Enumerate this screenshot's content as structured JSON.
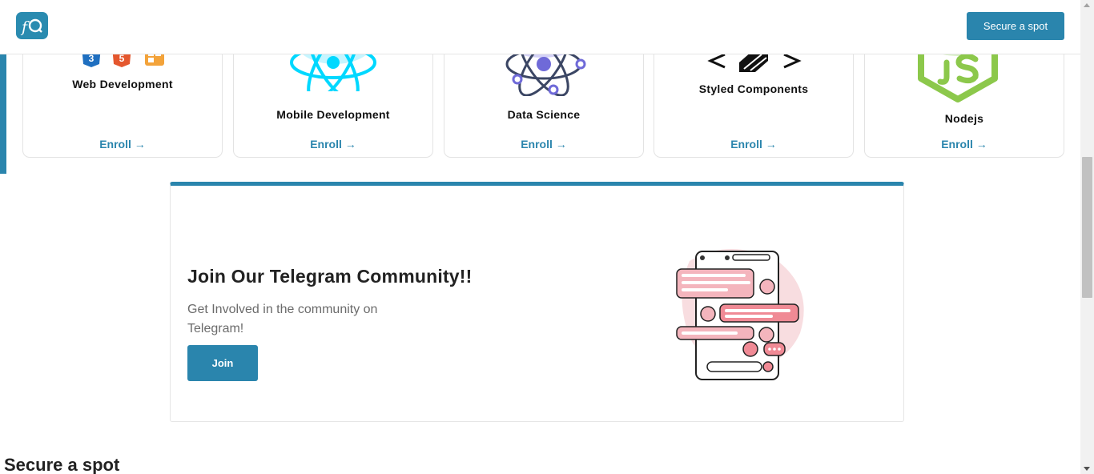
{
  "header": {
    "logo_text": "fC",
    "cta_label": "Secure a spot"
  },
  "courses": [
    {
      "title": "Web Development",
      "enroll": "Enroll →",
      "icon": "html-css-js-icon"
    },
    {
      "title": "Mobile Development",
      "enroll": "Enroll →",
      "icon": "react-icon"
    },
    {
      "title": "Data Science",
      "enroll": "Enroll →",
      "icon": "data-science-atom-icon"
    },
    {
      "title": "Styled Components",
      "enroll": "Enroll →",
      "icon": "styled-components-icon"
    },
    {
      "title": "Nodejs",
      "enroll": "Enroll →",
      "icon": "nodejs-icon"
    }
  ],
  "telegram": {
    "title": "Join Our Telegram Community!!",
    "description": "Get Involved in the community on Telegram!",
    "join_label": "Join",
    "illustration": "chat-phone-illustration"
  },
  "next_section": {
    "title": "Secure a spot"
  },
  "colors": {
    "accent": "#2a85ad",
    "react": "#00d8ff",
    "node": "#8cc84b"
  }
}
